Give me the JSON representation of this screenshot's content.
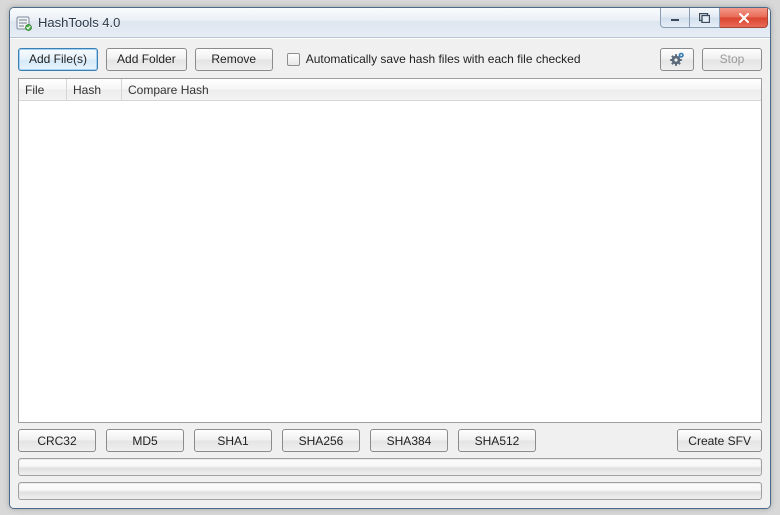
{
  "window": {
    "title": "HashTools 4.0"
  },
  "toolbar": {
    "add_files_label": "Add File(s)",
    "add_folder_label": "Add Folder",
    "remove_label": "Remove",
    "auto_save_label": "Automatically save hash files with each file checked",
    "auto_save_checked": false,
    "stop_label": "Stop"
  },
  "listview": {
    "columns": {
      "file": {
        "label": "File",
        "width": 48
      },
      "hash": {
        "label": "Hash",
        "width": 55
      },
      "compare": {
        "label": "Compare Hash"
      }
    },
    "rows": []
  },
  "hash_buttons": {
    "crc32": "CRC32",
    "md5": "MD5",
    "sha1": "SHA1",
    "sha256": "SHA256",
    "sha384": "SHA384",
    "sha512": "SHA512",
    "create_sfv": "Create SFV"
  },
  "progress": {
    "bar1_percent": 0,
    "bar2_percent": 0
  },
  "colors": {
    "accent": "#3c7fb1",
    "close": "#d94531"
  }
}
